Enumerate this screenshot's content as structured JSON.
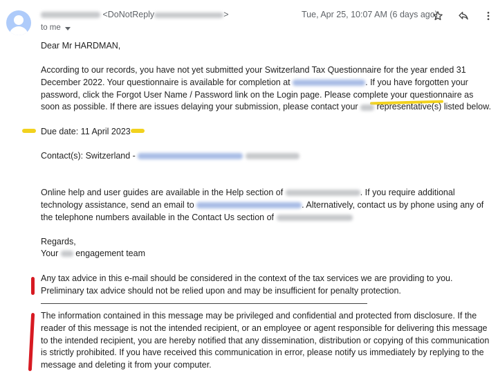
{
  "sender": {
    "address_suffix": "<DoNotReply",
    "address_end": ">"
  },
  "recipients": {
    "label": "to me"
  },
  "header": {
    "date": "Tue, Apr 25, 10:07 AM (6 days ago)"
  },
  "icons": [
    "star-icon",
    "reply-icon",
    "more-vert-icon",
    "avatar-icon",
    "chevron-down-icon"
  ],
  "colors": {
    "highlight": "#f2d21e",
    "red_marker": "#d71a22",
    "avatar": "#aecbfa"
  },
  "body": {
    "greeting": "Dear Mr HARDMAN,",
    "p2_a": "According to our records, you have not yet submitted your Switzerland Tax Questionnaire for the year ended 31 December 2022. Your questionnaire is available for completion at",
    "p2_b": ". If you have forgotten your password, click the Forgot User Name / Password link on the Login page. Please complete your questionnaire as soon as possible. If there are issues delaying your submission, please contact your",
    "p2_c": "representative(s) listed below.",
    "due_date": "Due date: 11 April 2023",
    "contacts": "Contact(s): Switzerland -",
    "p5_a": "Online help and user guides are available in the Help section of",
    "p5_b": ". If you require additional technology assistance, send an email to",
    "p5_c": ". Alternatively, contact us by phone using any of the telephone numbers available in the Contact Us section of",
    "regards": "Regards,",
    "your": "Your",
    "team": "engagement team",
    "tax_advice": "Any tax advice in this e-mail should be considered in the context of the tax services we are providing to you. Preliminary tax advice should not be relied upon and may be insufficient for penalty protection.",
    "disclaimer": "The information contained in this message may be privileged and confidential and protected from disclosure. If the reader of this message is not the intended recipient, or an employee or agent responsible for delivering this message to the intended recipient, you are hereby notified that any dissemination, distribution or copying of this communication is strictly prohibited. If you have received this communication in error, please notify us immediately by replying to the message and deleting it from your computer."
  }
}
